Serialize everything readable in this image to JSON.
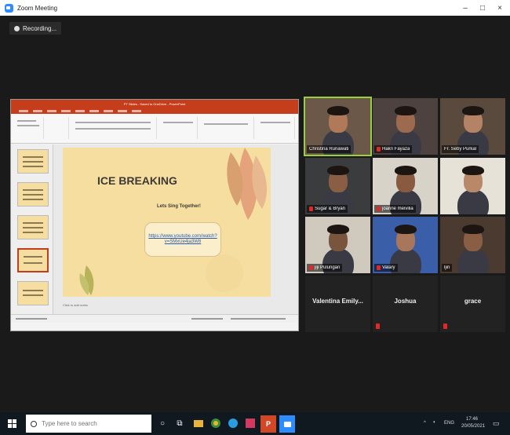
{
  "window": {
    "title": "Zoom Meeting",
    "controls": [
      "–",
      "□",
      "×"
    ]
  },
  "recording": {
    "label": "Recording..."
  },
  "share": {
    "ppt_title": "PT Slides - Saved to OneDrive - PowerPoint",
    "slide_title": "ICE BREAKING",
    "slide_subtitle": "Lets Sing Together!",
    "slide_link": "https://www.youtube.com/watch?v=SMxUe4ja3W8",
    "notes": "Click to add notes",
    "thumb_count": 5,
    "selected_thumb": 4
  },
  "participants": [
    {
      "name": "Christina Ruriawati",
      "video": true,
      "muted": false,
      "active": true,
      "bg": "#6b5848",
      "skin": "#b07a5a"
    },
    {
      "name": "Hakri Fayaza",
      "video": true,
      "muted": true,
      "bg": "#4e4240",
      "skin": "#9c6a4e"
    },
    {
      "name": "Fr. Seby Purkal",
      "video": true,
      "muted": false,
      "bg": "#5a4a3e",
      "skin": "#b48264"
    },
    {
      "name": "Sugar & Bryan",
      "video": true,
      "muted": true,
      "bg": "#3a3c3e",
      "skin": "#8a5e44"
    },
    {
      "name": "joanne meivilia",
      "video": true,
      "muted": true,
      "bg": "#d8d3c8",
      "skin": "#8a5a40"
    },
    {
      "name": "",
      "video": true,
      "muted": false,
      "bg": "#e7e2d8",
      "skin": "#b88868"
    },
    {
      "name": "jiji Pulungan",
      "video": true,
      "muted": true,
      "bg": "#cfc9be",
      "skin": "#7a553e"
    },
    {
      "name": "Valary",
      "video": true,
      "muted": true,
      "bg": "#3b5ea8",
      "skin": "#a8765a"
    },
    {
      "name": "ljin",
      "video": true,
      "muted": false,
      "bg": "#4a3a30",
      "skin": "#8a5e44"
    },
    {
      "name": "Valentina Emily...",
      "video": false,
      "muted": false
    },
    {
      "name": "Joshua",
      "video": false,
      "muted": true
    },
    {
      "name": "grace",
      "video": false,
      "muted": true
    }
  ],
  "taskbar": {
    "search_placeholder": "Type here to search",
    "tray_lang": "ENG",
    "time": "17:46",
    "date": "20/05/2021"
  },
  "colors": {
    "accent_active": "#9ad13a",
    "ppt_red": "#c43e1c",
    "slide_bg": "#f6dea1",
    "mic_muted": "#e02828"
  }
}
